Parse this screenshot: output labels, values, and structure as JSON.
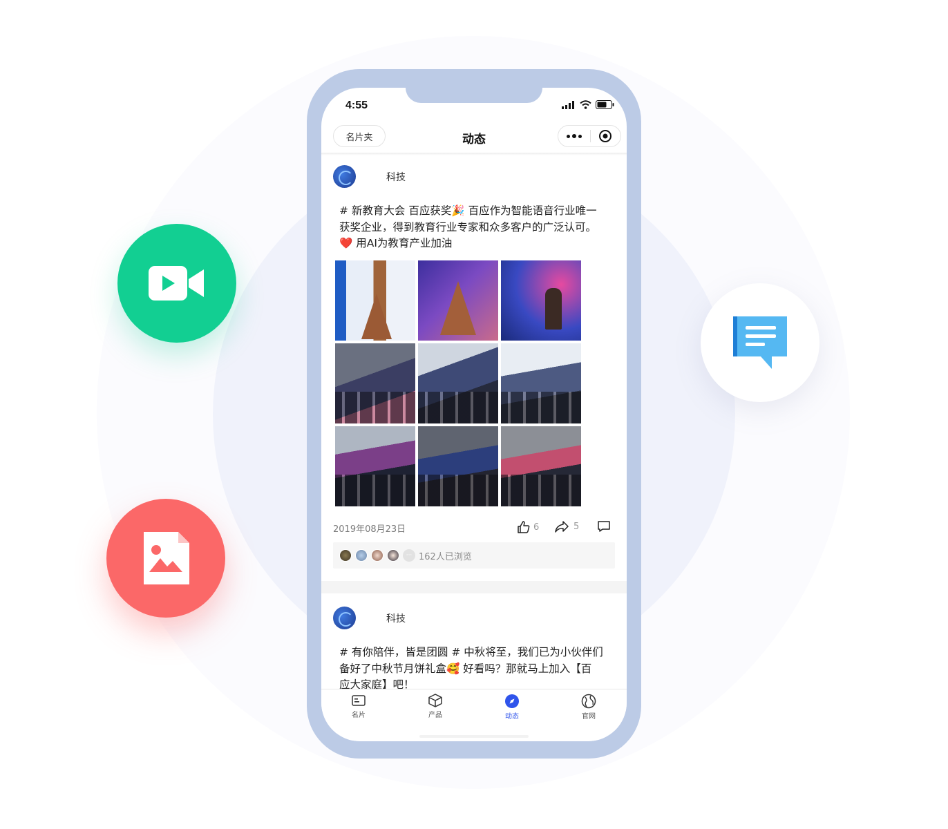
{
  "status_bar": {
    "time": "4:55"
  },
  "nav": {
    "left_button": "名片夹",
    "title": "动态"
  },
  "posts": [
    {
      "author": "科技",
      "text_line1": "# 新教育大会 百应获奖🎉 百应作为智能语音行业唯一",
      "text_line2": "获奖企业，得到教育行业专家和众多客户的广泛认可。",
      "text_line3": " 用AI为教育产业加油",
      "heart": "❤️",
      "photo_count": 9,
      "date": "2019年08月23日",
      "likes": "6",
      "shares": "5",
      "views": "162人已浏览"
    },
    {
      "author": "科技",
      "text_line1": "# 有你陪伴，皆是团圆 # 中秋将至，我们已为小伙伴们",
      "text_line2": "备好了中秋节月饼礼盒🥰 好看吗？那就马上加入【百",
      "text_line3": "应大家庭】吧！"
    }
  ],
  "tabbar": {
    "items": [
      {
        "label": "名片",
        "icon": "card-icon",
        "active": false
      },
      {
        "label": "产品",
        "icon": "box-icon",
        "active": false
      },
      {
        "label": "动态",
        "icon": "compass-icon",
        "active": true
      },
      {
        "label": "官网",
        "icon": "globe-icon",
        "active": false
      }
    ]
  },
  "badges": [
    {
      "icon": "video-camera-icon",
      "color": "#12cf92"
    },
    {
      "icon": "image-file-icon",
      "color": "#fb6868"
    },
    {
      "icon": "chat-message-icon",
      "color": "#4aa8ee"
    }
  ],
  "colors": {
    "accent": "#2f54eb",
    "phone_frame": "#bccbe6"
  }
}
